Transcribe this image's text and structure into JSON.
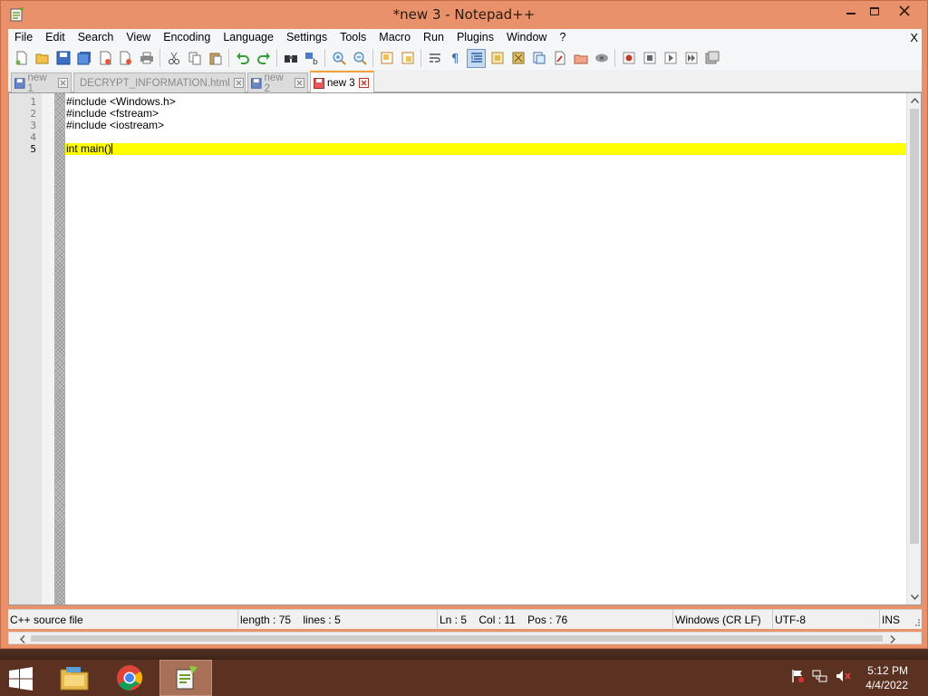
{
  "window": {
    "title": "*new 3 - Notepad++"
  },
  "menu": {
    "items": [
      "File",
      "Edit",
      "Search",
      "View",
      "Encoding",
      "Language",
      "Settings",
      "Tools",
      "Macro",
      "Run",
      "Plugins",
      "Window",
      "?"
    ],
    "close_label": "X"
  },
  "toolbar": {
    "icons": [
      "new-file-icon",
      "open-file-icon",
      "save-icon",
      "save-all-icon",
      "close-icon",
      "close-all-icon",
      "print-icon",
      "cut-icon",
      "copy-icon",
      "paste-icon",
      "undo-icon",
      "redo-icon",
      "find-icon",
      "replace-icon",
      "zoom-in-icon",
      "zoom-out-icon",
      "sync-vertical-icon",
      "sync-horizontal-icon",
      "word-wrap-icon",
      "show-all-chars-icon",
      "indent-guide-icon",
      "udl-icon",
      "doc-map-icon",
      "function-list-icon",
      "folder-as-workspace-icon",
      "monitoring-icon",
      "record-macro-icon",
      "stop-macro-icon",
      "play-macro-icon",
      "run-macro-multiple-icon",
      "save-macro-icon"
    ]
  },
  "tabs": [
    {
      "label": "new 1",
      "active": false,
      "modified": false
    },
    {
      "label": "DECRYPT_INFORMATION.html",
      "active": false,
      "modified": false
    },
    {
      "label": "new 2",
      "active": false,
      "modified": false
    },
    {
      "label": "new 3",
      "active": true,
      "modified": true
    }
  ],
  "editor": {
    "lines": [
      {
        "num": "1",
        "text": "#include <Windows.h>"
      },
      {
        "num": "2",
        "text": "#include <fstream>"
      },
      {
        "num": "3",
        "text": "#include <iostream>"
      },
      {
        "num": "4",
        "text": ""
      },
      {
        "num": "5",
        "text": "int main()"
      }
    ],
    "current_line": 5
  },
  "status": {
    "language": "C++ source file",
    "length": "length : 75    lines : 5",
    "position": "Ln : 5    Col : 11    Pos : 76",
    "eol": "Windows (CR LF)",
    "encoding": "UTF-8",
    "mode": "INS"
  },
  "taskbar": {
    "apps": [
      "file-explorer-icon",
      "chrome-icon",
      "notepad-plus-plus-icon"
    ],
    "active_app": "notepad-plus-plus-icon",
    "time": "5:12 PM",
    "date": "4/4/2022"
  },
  "colors": {
    "frame": "#e9916a",
    "current_line_highlight": "#ffff00",
    "taskbar": "#5b3122"
  }
}
